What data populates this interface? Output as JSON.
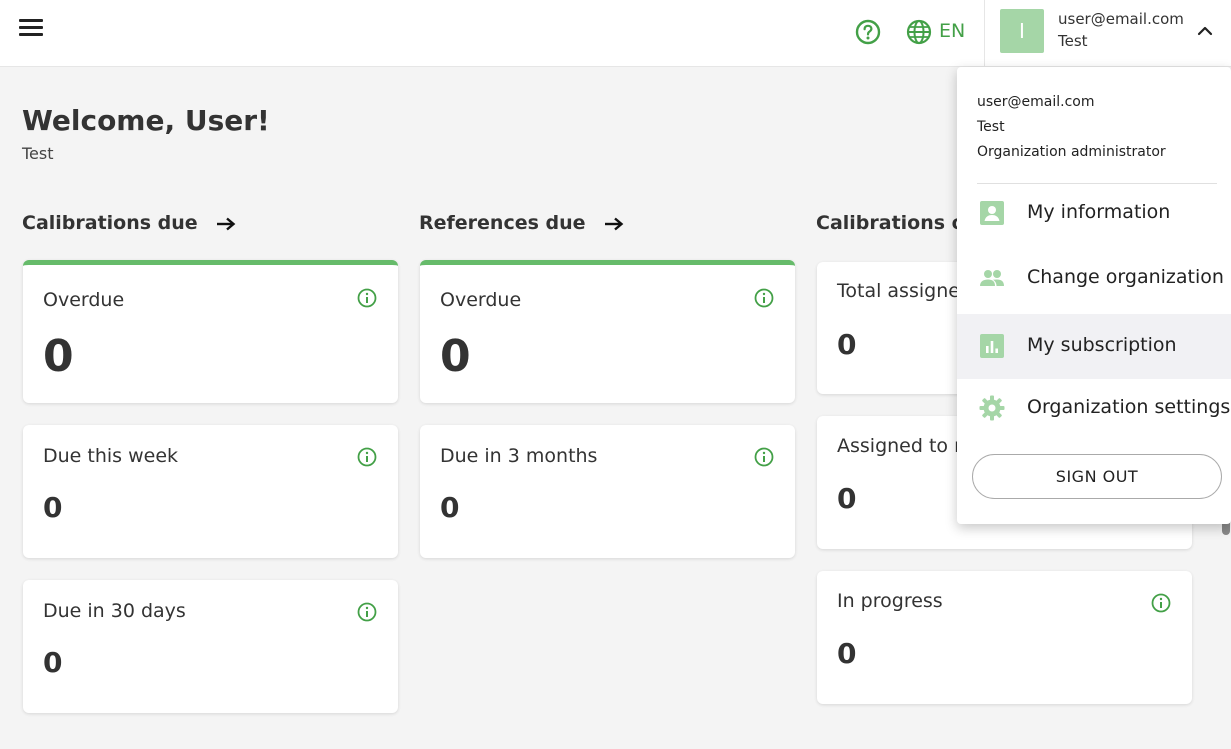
{
  "header": {
    "language": "EN",
    "user_email": "user@email.com",
    "user_org": "Test",
    "avatar_letter": "I",
    "accent_color": "#43a047"
  },
  "welcome": {
    "title": "Welcome, User!",
    "subtitle": "Test"
  },
  "sections": {
    "calibrations_due": {
      "title": "Calibrations due",
      "cards": [
        {
          "label": "Overdue",
          "value": "0"
        },
        {
          "label": "Due this week",
          "value": "0"
        },
        {
          "label": "Due in 30 days",
          "value": "0"
        }
      ]
    },
    "references_due": {
      "title": "References due",
      "cards": [
        {
          "label": "Overdue",
          "value": "0"
        },
        {
          "label": "Due in 3 months",
          "value": "0"
        }
      ]
    },
    "calibrations_ongoing": {
      "title": "Calibrations ong",
      "cards": [
        {
          "label": "Total assigned",
          "value": "0"
        },
        {
          "label": "Assigned to m",
          "value": "0"
        },
        {
          "label": "In progress",
          "value": "0"
        }
      ]
    }
  },
  "dropdown": {
    "email": "user@email.com",
    "org": "Test",
    "role": "Organization administrator",
    "items": [
      {
        "label": "My information",
        "icon": "account-box-icon"
      },
      {
        "label": "Change organization",
        "icon": "people-icon"
      },
      {
        "label": "My subscription",
        "icon": "bar-chart-icon"
      },
      {
        "label": "Organization settings",
        "icon": "gear-icon"
      }
    ],
    "signout_label": "SIGN OUT"
  }
}
